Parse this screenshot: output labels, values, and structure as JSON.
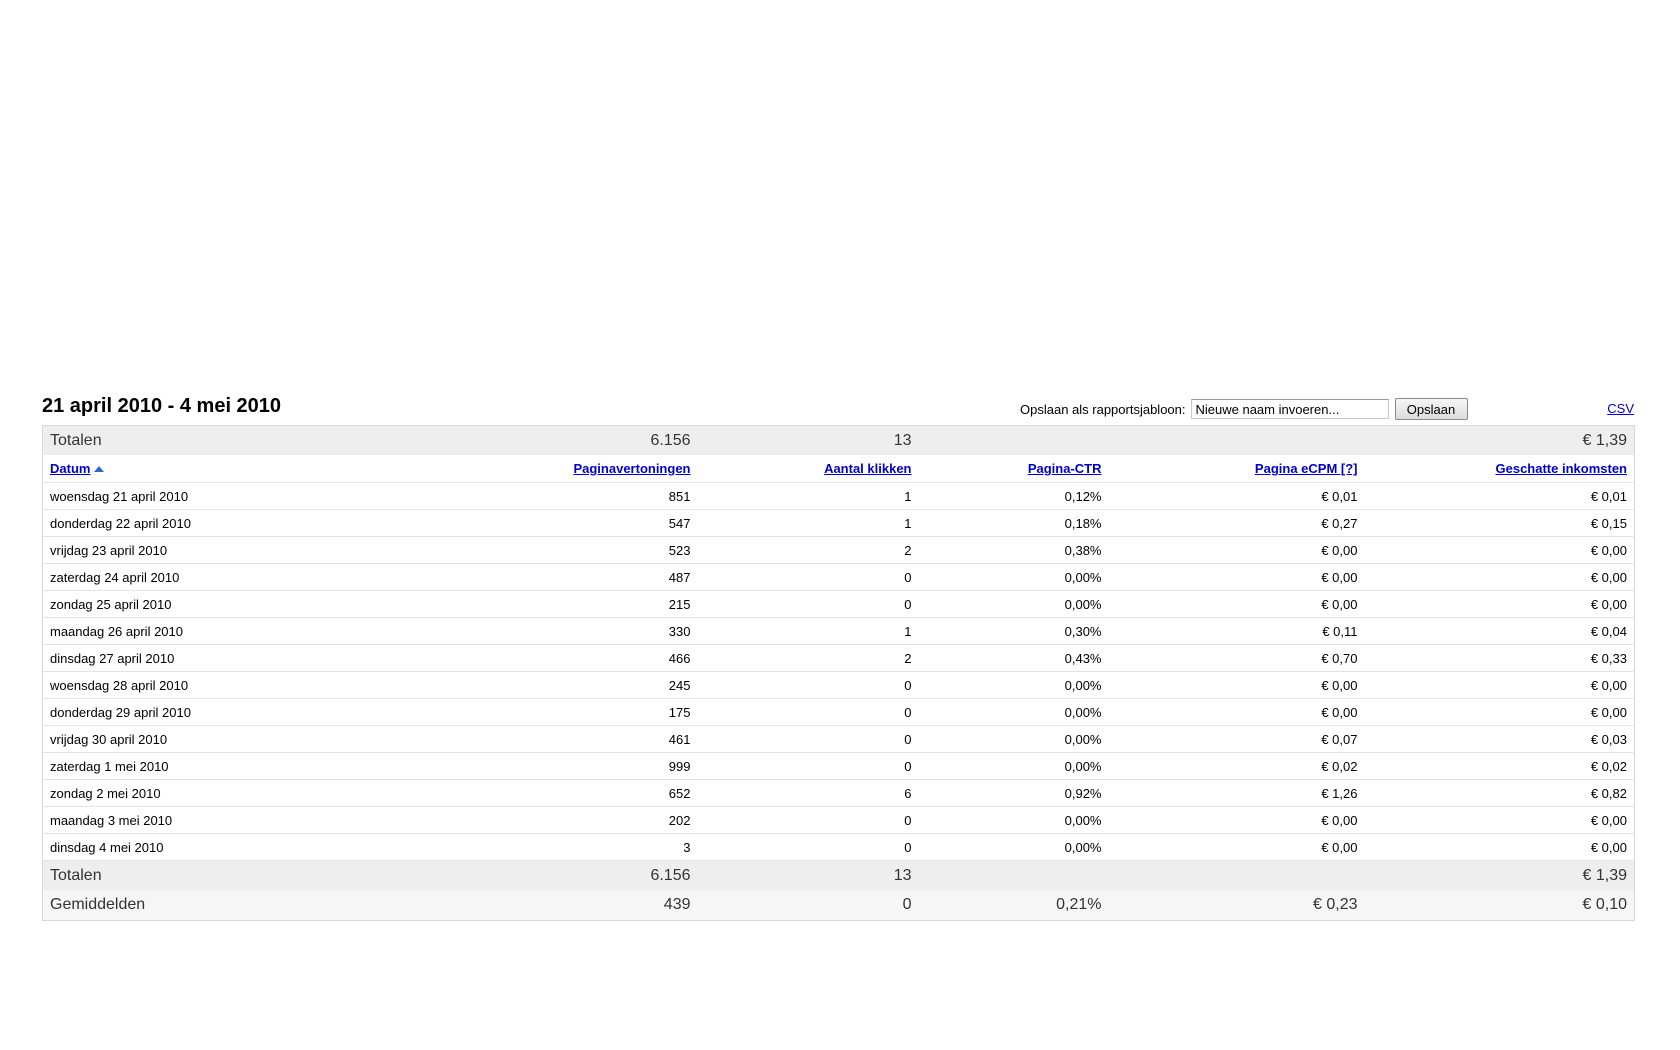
{
  "report": {
    "date_range": "21 april 2010 - 4 mei 2010",
    "template_label": "Opslaan als rapportsjabloon:",
    "template_placeholder": "Nieuwe naam invoeren...",
    "save_button": "Opslaan",
    "csv_link": "CSV"
  },
  "table": {
    "top_totals": {
      "label": "Totalen",
      "impressions": "6.156",
      "clicks": "13",
      "ctr": "",
      "ecpm": "",
      "earnings": "€ 1,39"
    },
    "headers": {
      "date": "Datum",
      "impressions": "Paginavertoningen",
      "clicks": "Aantal klikken",
      "ctr": "Pagina-CTR",
      "ecpm": "Pagina eCPM [?]",
      "earnings": "Geschatte inkomsten"
    },
    "rows": [
      {
        "date": "woensdag 21 april 2010",
        "impressions": "851",
        "clicks": "1",
        "ctr": "0,12%",
        "ecpm": "€ 0,01",
        "earnings": "€ 0,01"
      },
      {
        "date": "donderdag 22 april 2010",
        "impressions": "547",
        "clicks": "1",
        "ctr": "0,18%",
        "ecpm": "€ 0,27",
        "earnings": "€ 0,15"
      },
      {
        "date": "vrijdag 23 april 2010",
        "impressions": "523",
        "clicks": "2",
        "ctr": "0,38%",
        "ecpm": "€ 0,00",
        "earnings": "€ 0,00"
      },
      {
        "date": "zaterdag 24 april 2010",
        "impressions": "487",
        "clicks": "0",
        "ctr": "0,00%",
        "ecpm": "€ 0,00",
        "earnings": "€ 0,00"
      },
      {
        "date": "zondag 25 april 2010",
        "impressions": "215",
        "clicks": "0",
        "ctr": "0,00%",
        "ecpm": "€ 0,00",
        "earnings": "€ 0,00"
      },
      {
        "date": "maandag 26 april 2010",
        "impressions": "330",
        "clicks": "1",
        "ctr": "0,30%",
        "ecpm": "€ 0,11",
        "earnings": "€ 0,04"
      },
      {
        "date": "dinsdag 27 april 2010",
        "impressions": "466",
        "clicks": "2",
        "ctr": "0,43%",
        "ecpm": "€ 0,70",
        "earnings": "€ 0,33"
      },
      {
        "date": "woensdag 28 april 2010",
        "impressions": "245",
        "clicks": "0",
        "ctr": "0,00%",
        "ecpm": "€ 0,00",
        "earnings": "€ 0,00"
      },
      {
        "date": "donderdag 29 april 2010",
        "impressions": "175",
        "clicks": "0",
        "ctr": "0,00%",
        "ecpm": "€ 0,00",
        "earnings": "€ 0,00"
      },
      {
        "date": "vrijdag 30 april 2010",
        "impressions": "461",
        "clicks": "0",
        "ctr": "0,00%",
        "ecpm": "€ 0,07",
        "earnings": "€ 0,03"
      },
      {
        "date": "zaterdag 1 mei 2010",
        "impressions": "999",
        "clicks": "0",
        "ctr": "0,00%",
        "ecpm": "€ 0,02",
        "earnings": "€ 0,02"
      },
      {
        "date": "zondag 2 mei 2010",
        "impressions": "652",
        "clicks": "6",
        "ctr": "0,92%",
        "ecpm": "€ 1,26",
        "earnings": "€ 0,82"
      },
      {
        "date": "maandag 3 mei 2010",
        "impressions": "202",
        "clicks": "0",
        "ctr": "0,00%",
        "ecpm": "€ 0,00",
        "earnings": "€ 0,00"
      },
      {
        "date": "dinsdag 4 mei 2010",
        "impressions": "3",
        "clicks": "0",
        "ctr": "0,00%",
        "ecpm": "€ 0,00",
        "earnings": "€ 0,00"
      }
    ],
    "bottom_totals": {
      "label": "Totalen",
      "impressions": "6.156",
      "clicks": "13",
      "ctr": "",
      "ecpm": "",
      "earnings": "€ 1,39"
    },
    "averages": {
      "label": "Gemiddelden",
      "impressions": "439",
      "clicks": "0",
      "ctr": "0,21%",
      "ecpm": "€ 0,23",
      "earnings": "€ 0,10"
    }
  }
}
